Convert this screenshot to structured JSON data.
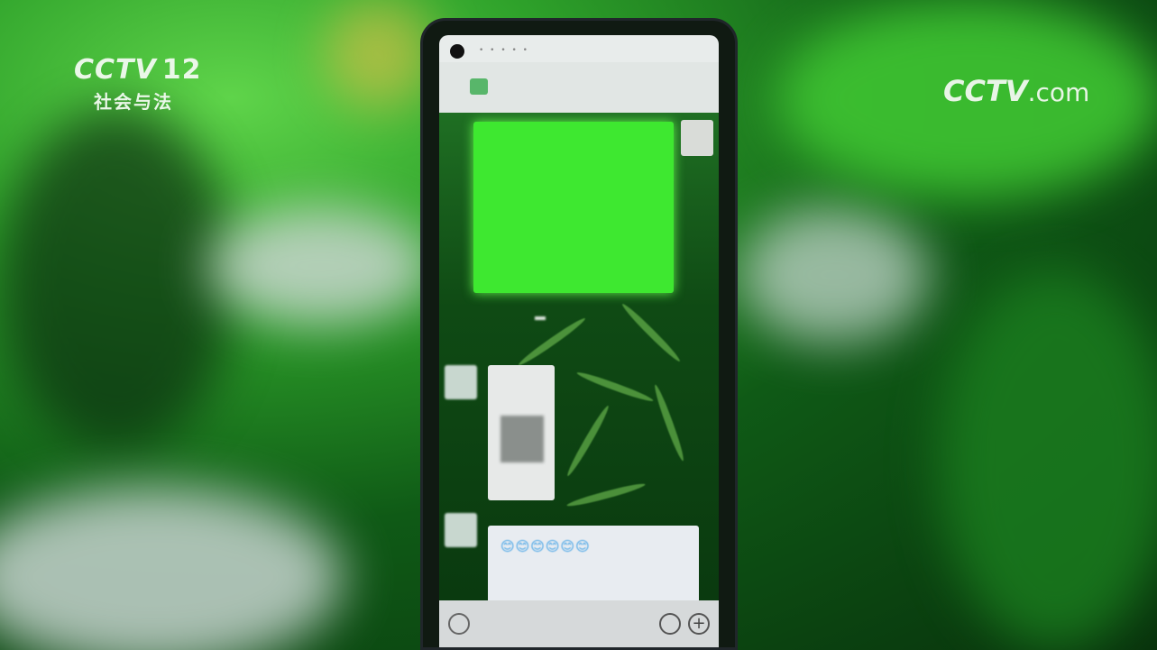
{
  "broadcast": {
    "channel_logo": "CCTV",
    "channel_number": "12",
    "channel_name": "社会与法",
    "watermark_logo": "CCTV",
    "watermark_suffix": ".com"
  },
  "phone_screen": {
    "chat_title": "",
    "green_message_text": "",
    "timestamp": "",
    "sender_name_1": "",
    "sender_name_2": "",
    "emoji_row": "😊😊😊😊😊😊",
    "number_text": ""
  },
  "icons": {
    "voice": "voice-input-icon",
    "emoji": "emoji-icon",
    "plus": "plus-icon"
  },
  "colors": {
    "background_green": "#2ea12a",
    "bubble_green": "#3ee830",
    "chat_bg": "#1f6f23",
    "highlight": "#f3b53c"
  }
}
